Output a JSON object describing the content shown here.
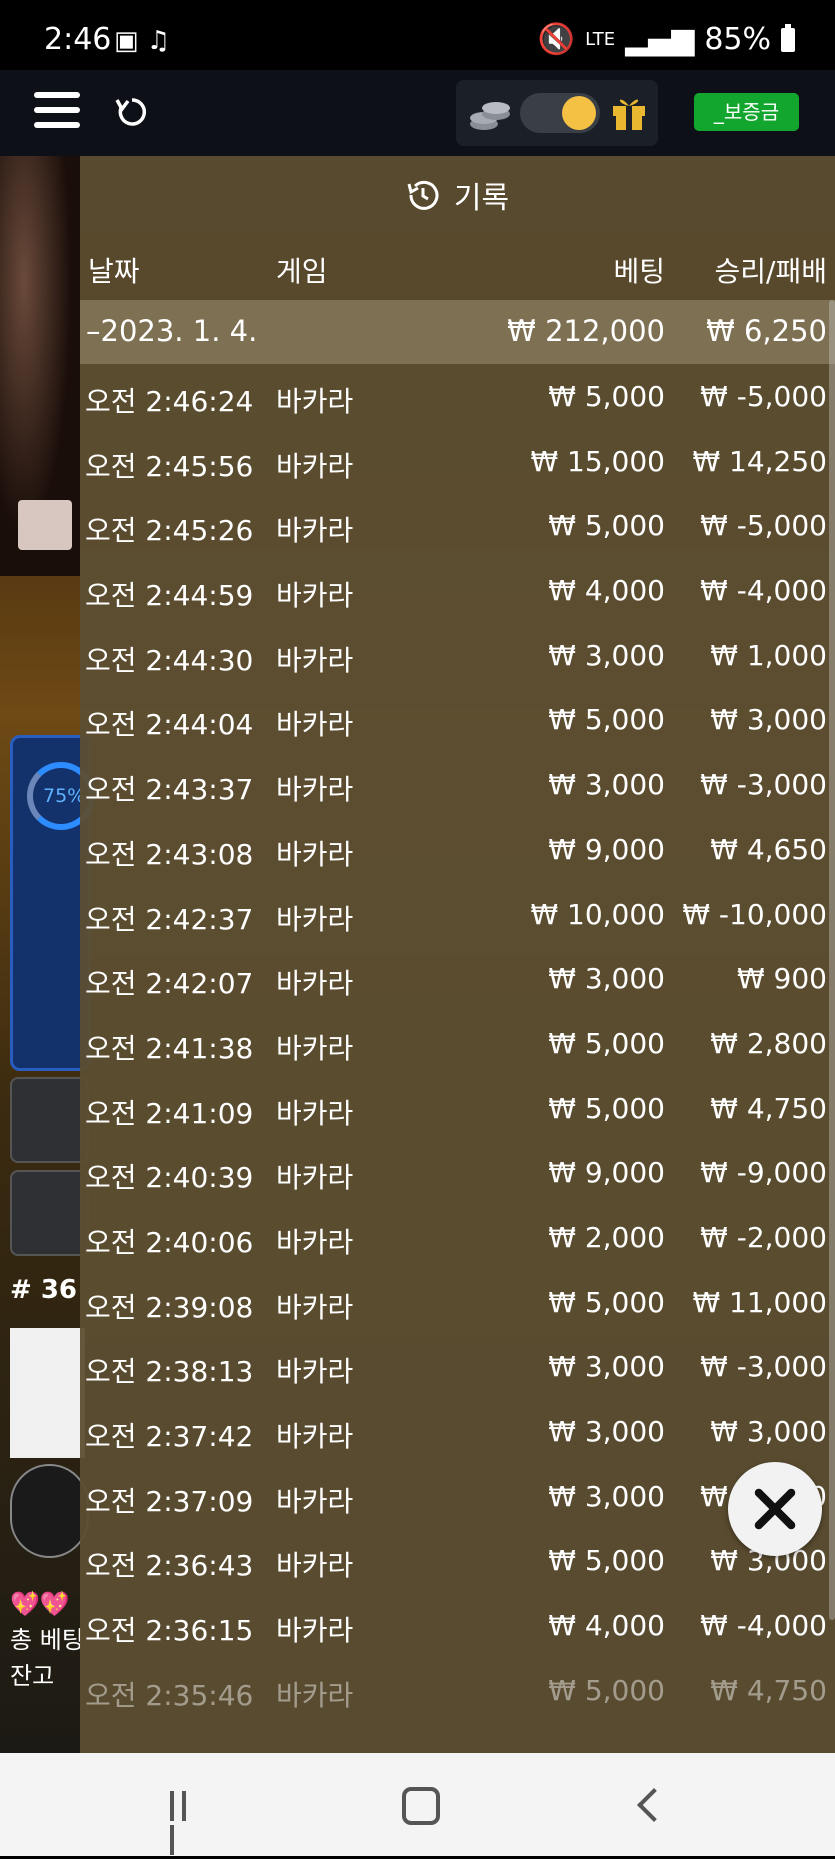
{
  "status_bar": {
    "time": "2:46",
    "battery": "85%",
    "network": "LTE"
  },
  "toolbar": {
    "deposit_label": "_보증금"
  },
  "game_side": {
    "progress": "75%",
    "round": "# 36",
    "bet_total_label": "총 베팅",
    "balance_label": "잔고"
  },
  "history": {
    "title": "기록",
    "columns": {
      "date": "날짜",
      "game": "게임",
      "bet": "베팅",
      "result": "승리/패배"
    },
    "day": {
      "date": "–2023. 1. 4.",
      "bet": "₩ 212,000",
      "result": "₩ 6,250"
    },
    "rows": [
      {
        "time": "오전 2:46:24",
        "game": "바카라",
        "bet": "₩ 5,000",
        "result": "₩ -5,000"
      },
      {
        "time": "오전 2:45:56",
        "game": "바카라",
        "bet": "₩ 15,000",
        "result": "₩ 14,250"
      },
      {
        "time": "오전 2:45:26",
        "game": "바카라",
        "bet": "₩ 5,000",
        "result": "₩ -5,000"
      },
      {
        "time": "오전 2:44:59",
        "game": "바카라",
        "bet": "₩ 4,000",
        "result": "₩ -4,000"
      },
      {
        "time": "오전 2:44:30",
        "game": "바카라",
        "bet": "₩ 3,000",
        "result": "₩ 1,000"
      },
      {
        "time": "오전 2:44:04",
        "game": "바카라",
        "bet": "₩ 5,000",
        "result": "₩ 3,000"
      },
      {
        "time": "오전 2:43:37",
        "game": "바카라",
        "bet": "₩ 3,000",
        "result": "₩ -3,000"
      },
      {
        "time": "오전 2:43:08",
        "game": "바카라",
        "bet": "₩ 9,000",
        "result": "₩ 4,650"
      },
      {
        "time": "오전 2:42:37",
        "game": "바카라",
        "bet": "₩ 10,000",
        "result": "₩ -10,000"
      },
      {
        "time": "오전 2:42:07",
        "game": "바카라",
        "bet": "₩ 3,000",
        "result": "₩ 900"
      },
      {
        "time": "오전 2:41:38",
        "game": "바카라",
        "bet": "₩ 5,000",
        "result": "₩ 2,800"
      },
      {
        "time": "오전 2:41:09",
        "game": "바카라",
        "bet": "₩ 5,000",
        "result": "₩ 4,750"
      },
      {
        "time": "오전 2:40:39",
        "game": "바카라",
        "bet": "₩ 9,000",
        "result": "₩ -9,000"
      },
      {
        "time": "오전 2:40:06",
        "game": "바카라",
        "bet": "₩ 2,000",
        "result": "₩ -2,000"
      },
      {
        "time": "오전 2:39:08",
        "game": "바카라",
        "bet": "₩ 5,000",
        "result": "₩ 11,000"
      },
      {
        "time": "오전 2:38:13",
        "game": "바카라",
        "bet": "₩ 3,000",
        "result": "₩ -3,000"
      },
      {
        "time": "오전 2:37:42",
        "game": "바카라",
        "bet": "₩ 3,000",
        "result": "₩ 3,000"
      },
      {
        "time": "오전 2:37:09",
        "game": "바카라",
        "bet": "₩ 3,000",
        "result": "₩ -3,000"
      },
      {
        "time": "오전 2:36:43",
        "game": "바카라",
        "bet": "₩ 5,000",
        "result": "₩ 3,000"
      },
      {
        "time": "오전 2:36:15",
        "game": "바카라",
        "bet": "₩ 4,000",
        "result": "₩ -4,000"
      },
      {
        "time": "오전 2:35:46",
        "game": "바카라",
        "bet": "₩ 5,000",
        "result": "₩ 4,750"
      }
    ]
  }
}
